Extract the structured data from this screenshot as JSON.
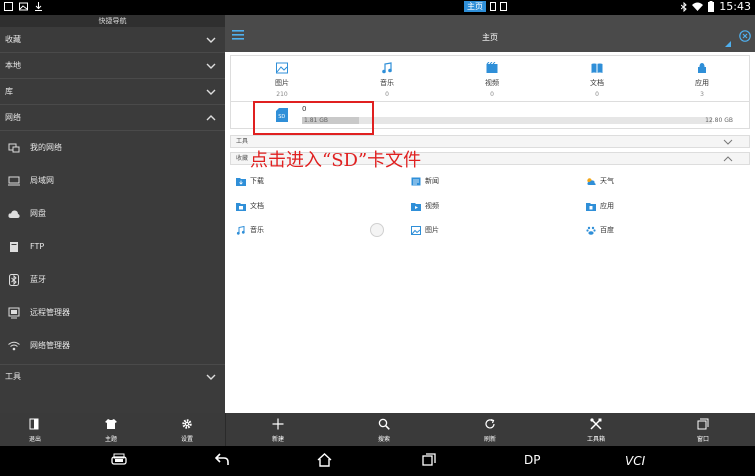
{
  "status_bar": {
    "home_label": "主页",
    "time": "15:43"
  },
  "sidebar": {
    "title": "快捷导航",
    "sections": [
      {
        "label": "收藏"
      },
      {
        "label": "本地"
      },
      {
        "label": "库"
      },
      {
        "label": "网络"
      }
    ],
    "network_items": [
      {
        "label": "我的网络",
        "icon": "my-network-icon"
      },
      {
        "label": "局域网",
        "icon": "lan-icon"
      },
      {
        "label": "网盘",
        "icon": "cloud-icon"
      },
      {
        "label": "FTP",
        "icon": "ftp-icon"
      },
      {
        "label": "蓝牙",
        "icon": "bluetooth-icon"
      },
      {
        "label": "远程管理器",
        "icon": "remote-manager-icon"
      },
      {
        "label": "网络管理器",
        "icon": "wifi-icon"
      }
    ],
    "tools_label": "工具"
  },
  "header": {
    "title": "主页"
  },
  "categories": [
    {
      "label": "图片",
      "count": "210",
      "icon": "image-icon"
    },
    {
      "label": "音乐",
      "count": "0",
      "icon": "music-icon"
    },
    {
      "label": "视频",
      "count": "0",
      "icon": "video-icon"
    },
    {
      "label": "文档",
      "count": "0",
      "icon": "document-icon"
    },
    {
      "label": "应用",
      "count": "3",
      "icon": "app-icon"
    }
  ],
  "storage": {
    "count": "0",
    "used": "1.81 GB",
    "total": "12.80 GB",
    "used_fraction": 0.14
  },
  "tools_row": {
    "label": "工具"
  },
  "favorites_row": {
    "label": "收藏"
  },
  "annotation": "点击进入“SD”卡文件",
  "favorites": [
    {
      "label": "下载",
      "icon": "download-folder-icon"
    },
    {
      "label": "新闻",
      "icon": "news-icon"
    },
    {
      "label": "天气",
      "icon": "weather-icon"
    },
    {
      "label": "文档",
      "icon": "document-folder-icon"
    },
    {
      "label": "视频",
      "icon": "video-folder-icon"
    },
    {
      "label": "应用",
      "icon": "app-folder-icon"
    },
    {
      "label": "音乐",
      "icon": "music-folder-icon"
    },
    {
      "label": "图片",
      "icon": "image-folder-icon"
    },
    {
      "label": "百度",
      "icon": "baidu-icon"
    }
  ],
  "bottom_bar": {
    "left": [
      {
        "label": "退出",
        "icon": "exit-icon"
      },
      {
        "label": "主题",
        "icon": "theme-icon"
      },
      {
        "label": "设置",
        "icon": "gear-icon"
      }
    ],
    "right": [
      {
        "label": "新建",
        "icon": "plus-icon"
      },
      {
        "label": "搜索",
        "icon": "search-icon"
      },
      {
        "label": "刷新",
        "icon": "refresh-icon"
      },
      {
        "label": "工具箱",
        "icon": "toolbox-icon"
      },
      {
        "label": "窗口",
        "icon": "window-icon"
      }
    ]
  },
  "nav_bar": {
    "dp_label": "DP",
    "vci_label": "VCI"
  },
  "colors": {
    "accent": "#2f8fd8",
    "annotation": "#e02020",
    "sidebar_bg": "#3b3b3b",
    "topbar_bg": "#4a4a4a"
  }
}
